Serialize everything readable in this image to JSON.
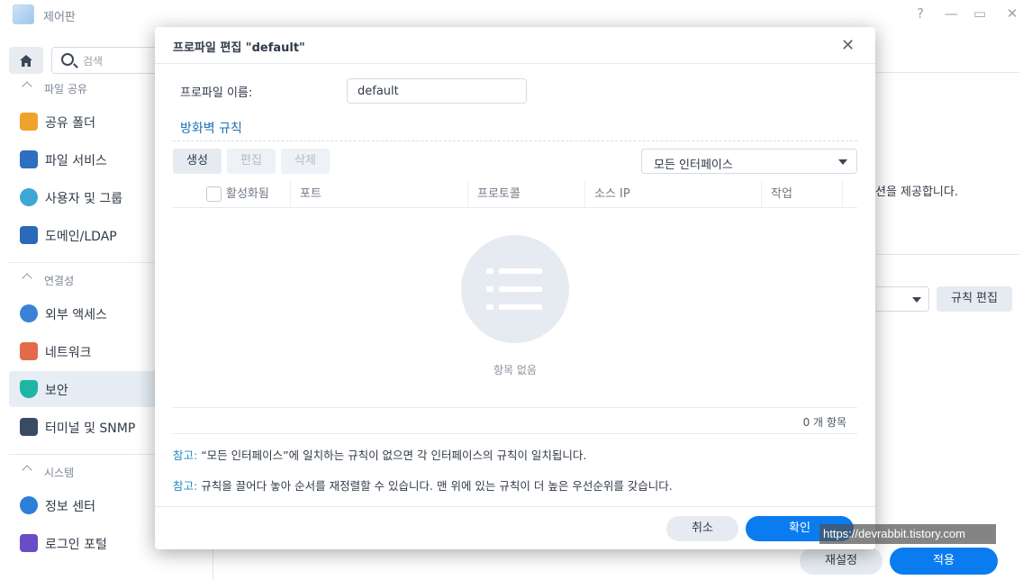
{
  "app": {
    "title": "제어판"
  },
  "window_controls": {
    "help": "?",
    "minimize": "—",
    "maximize": "▭",
    "close": "✕"
  },
  "sidebar": {
    "search_placeholder": "검색",
    "sections": [
      {
        "label": "파일 공유",
        "items": [
          "공유 폴더",
          "파일 서비스",
          "사용자 및 그룹",
          "도메인/LDAP"
        ]
      },
      {
        "label": "연결성",
        "items": [
          "외부 액세스",
          "네트워크",
          "보안",
          "터미널 및 SNMP"
        ]
      },
      {
        "label": "시스템",
        "items": [
          "정보 센터",
          "로그인 포털"
        ]
      }
    ],
    "active_item": "보안"
  },
  "background": {
    "partial_text": "션을 제공합니다.",
    "edit_rules_button": "규칙 편집",
    "reset_button": "재설정",
    "apply_button": "적용"
  },
  "dialog": {
    "title": "프로파일 편집 \"default\"",
    "profile_name_label": "프로파일 이름:",
    "profile_name_value": "default",
    "rules_section_title": "방화벽 규칙",
    "toolbar": {
      "create": "생성",
      "edit": "편집",
      "delete": "삭제"
    },
    "interface_select": "모든 인터페이스",
    "columns": [
      "활성화됨",
      "포트",
      "프로토콜",
      "소스 IP",
      "작업"
    ],
    "empty_text": "항목 없음",
    "count_text": "0 개 항목",
    "notes": [
      {
        "key": "참고:",
        "text": " “모든 인터페이스”에 일치하는 규칙이 없으면 각 인터페이스의 규칙이 일치됩니다."
      },
      {
        "key": "참고:",
        "text": " 규칙을 끌어다 놓아 순서를 재정렬할 수 있습니다. 맨 위에 있는 규칙이 더 높은 우선순위를 갖습니다."
      }
    ],
    "cancel_button": "취소",
    "ok_button": "확인"
  },
  "watermark": "https://devrabbit.tistory.com",
  "colors": {
    "accent": "#0a7cf0",
    "link": "#1f6fb5",
    "note_key": "#1f8fbf"
  }
}
